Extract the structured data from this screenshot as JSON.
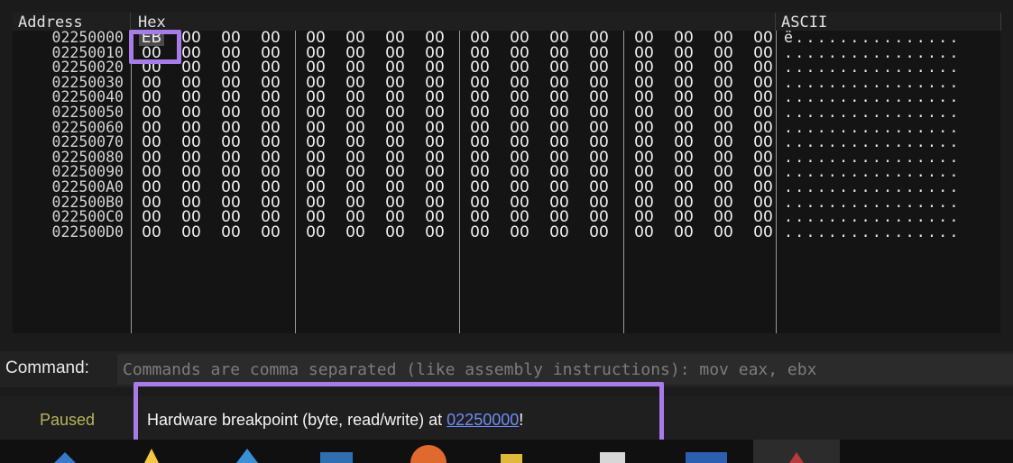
{
  "columns": {
    "address": "Address",
    "hex": "Hex",
    "ascii": "ASCII"
  },
  "rows": [
    {
      "addr": "02250000",
      "ascii": "ë..............."
    },
    {
      "addr": "02250010",
      "ascii": "................"
    },
    {
      "addr": "02250020",
      "ascii": "................"
    },
    {
      "addr": "02250030",
      "ascii": "................"
    },
    {
      "addr": "02250040",
      "ascii": "................"
    },
    {
      "addr": "02250050",
      "ascii": "................"
    },
    {
      "addr": "02250060",
      "ascii": "................"
    },
    {
      "addr": "02250070",
      "ascii": "................"
    },
    {
      "addr": "02250080",
      "ascii": "................"
    },
    {
      "addr": "02250090",
      "ascii": "................"
    },
    {
      "addr": "022500A0",
      "ascii": "................"
    },
    {
      "addr": "022500B0",
      "ascii": "................"
    },
    {
      "addr": "022500C0",
      "ascii": "................"
    },
    {
      "addr": "022500D0",
      "ascii": "................"
    }
  ],
  "first_byte": "EB",
  "byte_value": "00",
  "command": {
    "label": "Command:",
    "placeholder": "Commands are comma separated (like assembly instructions): mov eax, ebx"
  },
  "status": {
    "state": "Paused",
    "message_prefix": "Hardware breakpoint (byte, read/write) at ",
    "message_link": "02250000",
    "message_suffix": "!"
  },
  "colors": {
    "highlight": "#a77be8",
    "paused": "#b8b35a",
    "link": "#6f8cf5"
  },
  "taskbar_icons": [
    "app-icon",
    "folder-icon",
    "terminal-icon",
    "browser-icon",
    "explorer-icon",
    "notepad-icon",
    "window-icon",
    "debugger-icon"
  ]
}
